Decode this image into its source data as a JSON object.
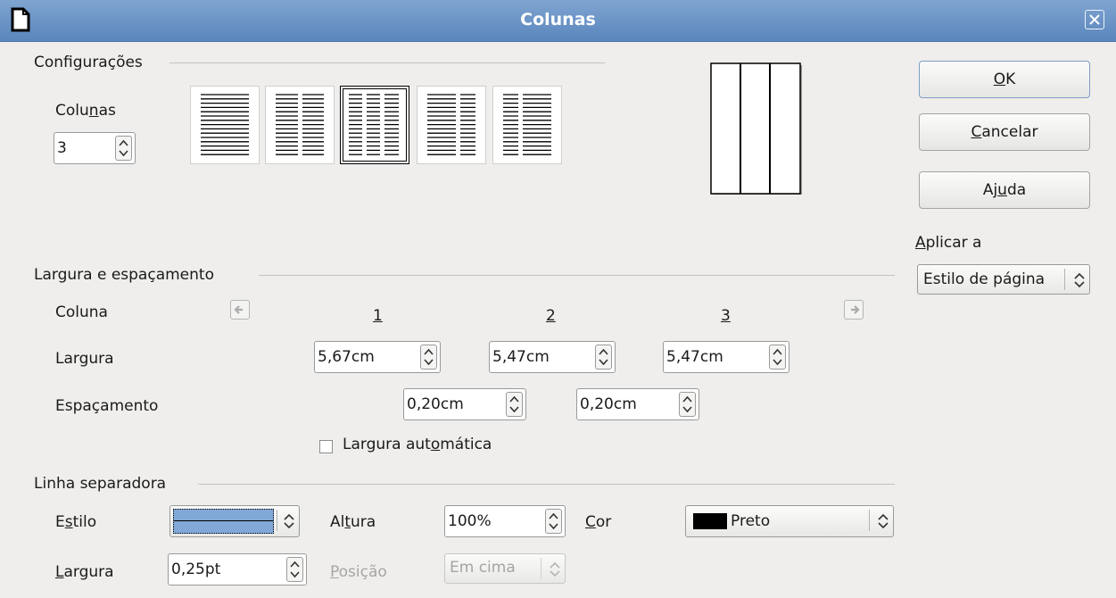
{
  "window": {
    "title": "Colunas"
  },
  "settings": {
    "group_label": "Configurações",
    "columns_label": "Colunas",
    "columns_value": "3",
    "layouts": [
      {
        "name": "1 column"
      },
      {
        "name": "2 columns"
      },
      {
        "name": "3 columns",
        "selected": true
      },
      {
        "name": "2 columns left wider"
      },
      {
        "name": "2 columns right wider"
      }
    ]
  },
  "buttons": {
    "ok": "OK",
    "cancel": "Cancelar",
    "help": "Ajuda"
  },
  "apply_to": {
    "label": "Aplicar a",
    "value": "Estilo de página"
  },
  "width_spacing": {
    "group_label": "Largura e espaçamento",
    "column_label": "Coluna",
    "width_label": "Largura",
    "spacing_label": "Espaçamento",
    "column_numbers": [
      "1",
      "2",
      "3"
    ],
    "widths": [
      "5,67cm",
      "5,47cm",
      "5,47cm"
    ],
    "spacings": [
      "0,20cm",
      "0,20cm"
    ],
    "autowidth_label": "Largura automática",
    "autowidth_checked": false
  },
  "separator": {
    "group_label": "Linha separadora",
    "style_label": "Estilo",
    "height_label": "Altura",
    "height_value": "100%",
    "color_label": "Cor",
    "color_value": "Preto",
    "color_swatch": "#000000",
    "width_label": "Largura",
    "width_value": "0,25pt",
    "position_label": "Posição",
    "position_value": "Em cima"
  },
  "colors": {
    "titlebar": "#6a93c8",
    "selection": "#82a8d8"
  },
  "icons": [
    "app-icon",
    "close-icon",
    "spin-arrows-icon",
    "left-arrow-icon",
    "right-arrow-icon",
    "checkbox-icon",
    "combo-arrows-icon"
  ]
}
